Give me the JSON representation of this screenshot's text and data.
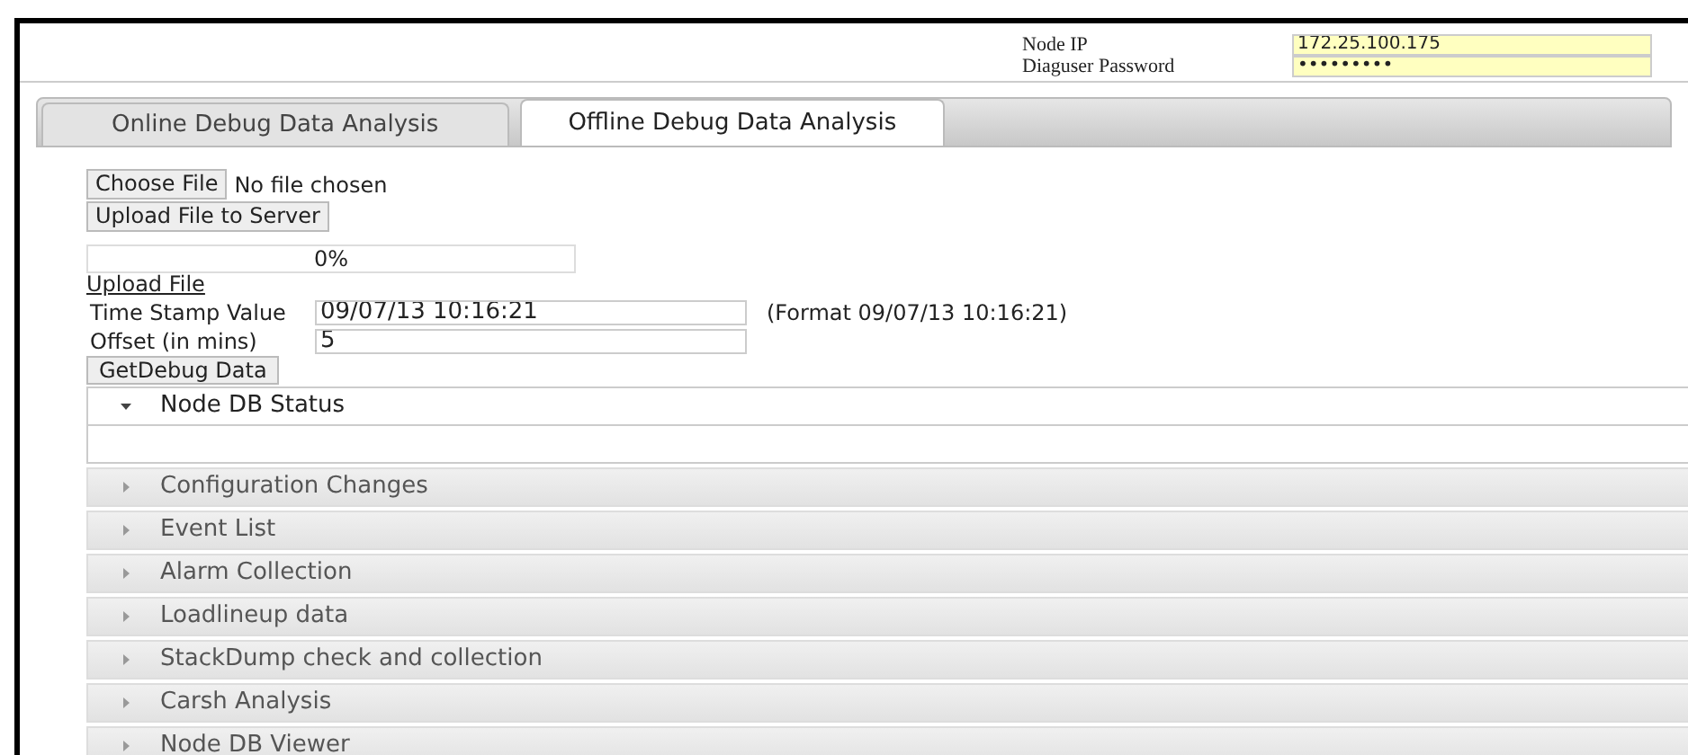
{
  "header": {
    "fields": [
      {
        "label": "Node IP",
        "value": "172.25.100.175"
      },
      {
        "label": "Diaguser Password",
        "value": "•••••••••"
      }
    ]
  },
  "tabs": [
    {
      "label": "Online Debug Data Analysis",
      "selected": false
    },
    {
      "label": "Offline Debug Data Analysis",
      "selected": true
    }
  ],
  "file_picker": {
    "button": "Choose File",
    "status": "No file chosen"
  },
  "upload_button": "Upload File to Server",
  "progress": {
    "level": 0,
    "reading": "0%"
  },
  "upload_link": "Upload File",
  "form": [
    {
      "label": "Time Stamp Value",
      "value": "09/07/13 10:16:21",
      "hint": "(Format 09/07/13 10:16:21)"
    },
    {
      "label": "Offset (in mins)",
      "value": "5"
    }
  ],
  "get_button": "GetDebug Data",
  "accordion": [
    {
      "title": "Node DB Status",
      "expanded": true
    },
    {
      "title": "Configuration Changes",
      "expanded": false
    },
    {
      "title": "Event List",
      "expanded": false
    },
    {
      "title": "Alarm Collection",
      "expanded": false
    },
    {
      "title": "Loadlineup data",
      "expanded": false
    },
    {
      "title": "StackDump check and collection",
      "expanded": false
    },
    {
      "title": "Carsh Analysis",
      "expanded": false
    },
    {
      "title": "Node DB Viewer",
      "expanded": false
    }
  ]
}
